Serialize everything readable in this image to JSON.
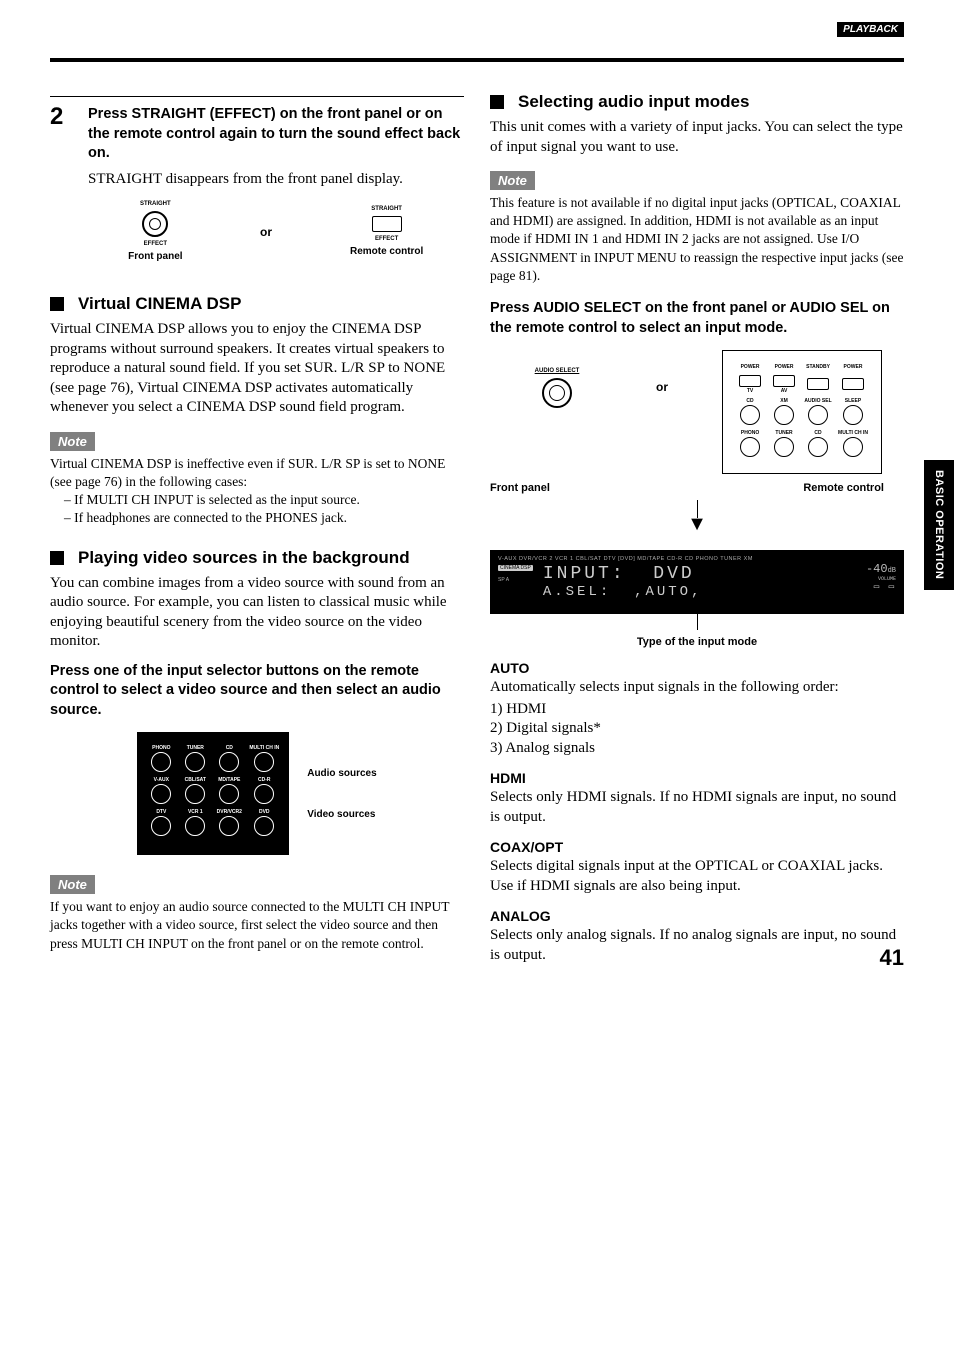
{
  "header": {
    "section": "PLAYBACK"
  },
  "side_tab": "BASIC OPERATION",
  "page_number": "41",
  "left": {
    "step_number": "2",
    "step_title": "Press STRAIGHT (EFFECT) on the front panel or on the remote control again to turn the sound effect back on.",
    "step_after": "STRAIGHT disappears from the front panel display.",
    "diag1": {
      "straight1": "STRAIGHT",
      "effect1": "EFFECT",
      "front": "Front panel",
      "or": "or",
      "straight2": "STRAIGHT",
      "effect2": "EFFECT",
      "remote": "Remote control"
    },
    "h1": "Virtual CINEMA DSP",
    "p1": "Virtual CINEMA DSP allows you to enjoy the CINEMA DSP programs without surround speakers. It creates virtual speakers to reproduce a natural sound field. If you set SUR. L/R SP to NONE (see page 76), Virtual CINEMA DSP activates automatically whenever you select a CINEMA DSP sound field program.",
    "note1": "Note",
    "note1_body": "Virtual CINEMA DSP is ineffective even if SUR. L/R SP is set to NONE (see page 76) in the following cases:",
    "note1_li1": "– If MULTI CH INPUT is selected as the input source.",
    "note1_li2": "– If headphones are connected to the PHONES jack.",
    "h2": "Playing video sources in the background",
    "p2": "You can combine images from a video source with sound from an audio source. For example, you can listen to classical music while enjoying beautiful scenery from the video source on the video monitor.",
    "instr2": "Press one of the input selector buttons on the remote control to select a video source and then select an audio source.",
    "diag2": {
      "audio_src": "Audio sources",
      "video_src": "Video sources",
      "btns": {
        "r1": [
          "PHONO",
          "TUNER",
          "CD",
          "MULTI CH IN"
        ],
        "r2": [
          "V-AUX",
          "CBL/SAT",
          "MD/TAPE",
          "CD-R"
        ],
        "r3": [
          "DTV",
          "VCR 1",
          "DVR/VCR2",
          "DVD"
        ]
      }
    },
    "note2": "Note",
    "note2_body": "If you want to enjoy an audio source connected to the MULTI CH INPUT jacks together with a video source, first select the video source and then press MULTI CH INPUT on the front panel or on the remote control."
  },
  "right": {
    "h1": "Selecting audio input modes",
    "p1": "This unit comes with a variety of input jacks. You can select the type of input signal you want to use.",
    "note1": "Note",
    "note1_body": "This feature is not available if no digital input jacks (OPTICAL, COAXIAL and HDMI) are assigned. In addition, HDMI is not available as an input mode if HDMI IN 1 and HDMI IN 2 jacks are not assigned. Use I/O ASSIGNMENT in INPUT MENU to reassign the respective input jacks (see page 81).",
    "instr1": "Press AUDIO SELECT on the front panel or AUDIO SEL on the remote control to select an input mode.",
    "diag1": {
      "audio_select": "AUDIO SELECT",
      "front": "Front panel",
      "or": "or",
      "remote": "Remote control",
      "remote_btns": {
        "r0": [
          "POWER",
          "POWER",
          "STANDBY",
          "POWER"
        ],
        "r1": [
          "TV",
          "AV",
          "",
          ""
        ],
        "r2": [
          "CD",
          "XM",
          "AUDIO SEL",
          "SLEEP"
        ],
        "r3": [
          "PHONO",
          "TUNER",
          "CD",
          "MULTI CH IN"
        ]
      }
    },
    "display": {
      "sources": "V-AUX  DVR/VCR 2  VCR 1  CBL/SAT  DTV  [DVD]  MD/TAPE  CD-R  CD  PHONO  TUNER  XM",
      "cinema": "CINEMA DSP",
      "sp": "SP A",
      "line1_l": "INPUT:",
      "line1_r": "DVD",
      "db": "-40",
      "db_lbl": "dB",
      "vol": "VOLUME",
      "line2_l": "A.SEL:",
      "line2_r": ",AUTO,",
      "caption": "Type of the input mode"
    },
    "modes": {
      "auto_h": "AUTO",
      "auto_p": "Automatically selects input signals in the following order:",
      "auto_1": "1) HDMI",
      "auto_2": "2) Digital signals*",
      "auto_3": "3) Analog signals",
      "hdmi_h": "HDMI",
      "hdmi_p": "Selects only HDMI signals. If no HDMI signals are input, no sound is output.",
      "coax_h": "COAX/OPT",
      "coax_p": "Selects digital signals input at the OPTICAL or COAXIAL jacks. Use if HDMI signals are also being input.",
      "analog_h": "ANALOG",
      "analog_p": "Selects only analog signals. If no analog signals are input, no sound is output."
    }
  }
}
